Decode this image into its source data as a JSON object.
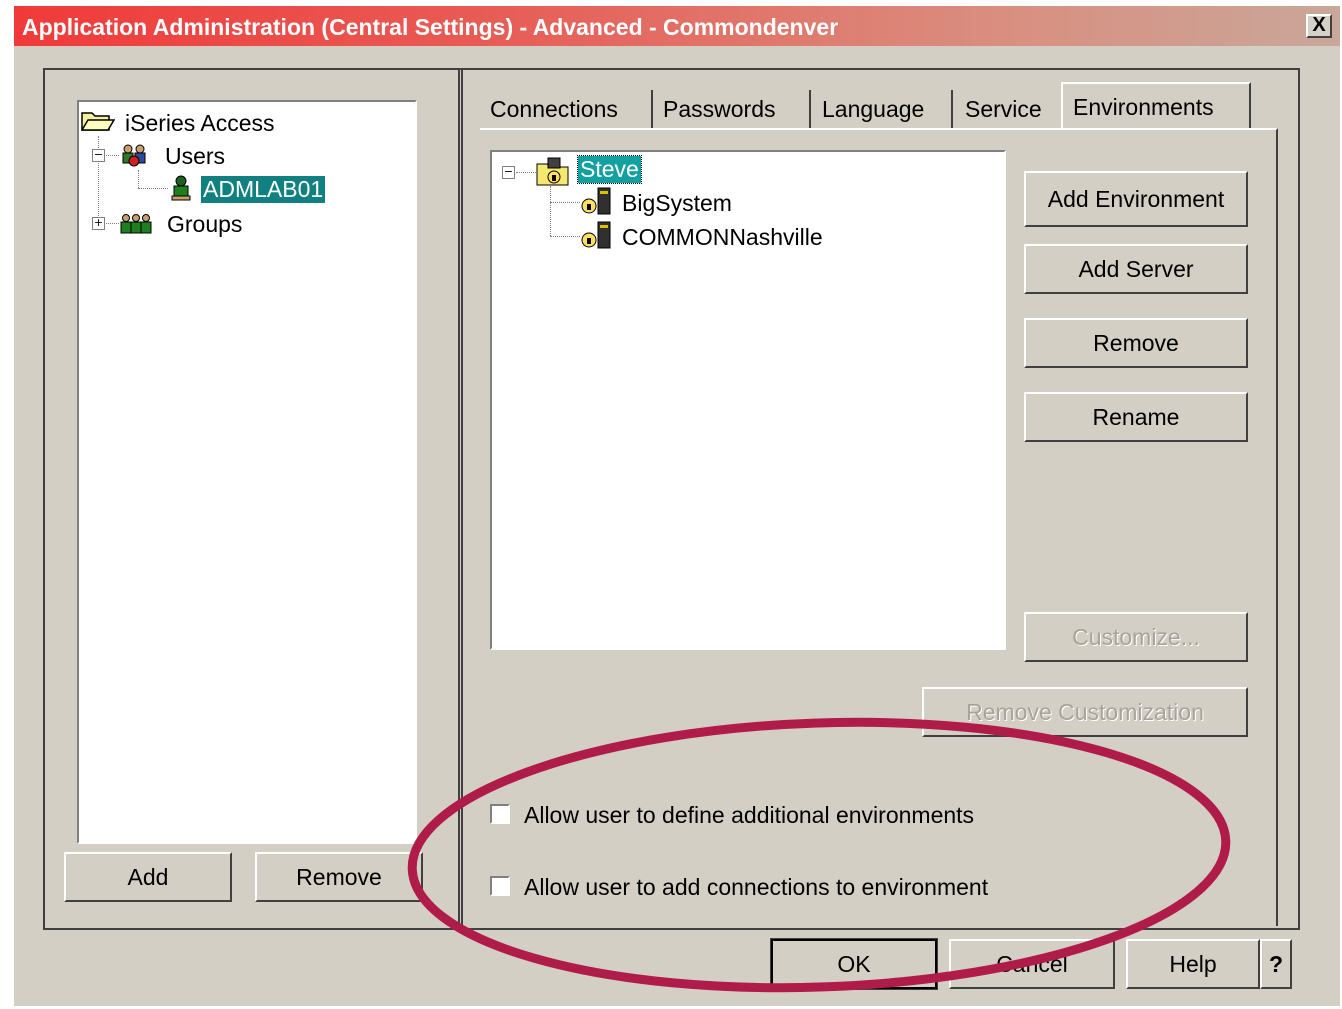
{
  "window": {
    "title": "Application Administration (Central Settings) - Advanced - Commondenver",
    "close_glyph": "X"
  },
  "left_tree": {
    "root_label": "iSeries Access",
    "users_label": "Users",
    "user_item": "ADMLAB01",
    "groups_label": "Groups",
    "users_expander": "−",
    "groups_expander": "+"
  },
  "left_buttons": {
    "add": "Add",
    "remove": "Remove"
  },
  "tabs": [
    "Connections",
    "Passwords",
    "Language",
    "Service",
    "Environments"
  ],
  "active_tab": "Environments",
  "env_tree": {
    "root_label": "Steve",
    "root_expander": "−",
    "servers": [
      "BigSystem",
      "COMMONNashville"
    ]
  },
  "env_buttons": {
    "add_environment": "Add Environment",
    "add_server": "Add Server",
    "remove": "Remove",
    "rename": "Rename",
    "customize": "Customize...",
    "remove_customization": "Remove Customization"
  },
  "options": {
    "allow_define_env": {
      "label": "Allow user to define additional environments",
      "checked": false
    },
    "allow_add_connections": {
      "label": "Allow user to add connections to environment",
      "checked": false
    }
  },
  "footer_buttons": {
    "ok": "OK",
    "cancel": "Cancel",
    "help": "Help",
    "whats_this": "?"
  },
  "colors": {
    "titlebar_start": "#f03a3a",
    "selection": "#118080",
    "annotation_ellipse": "#b01c4a"
  }
}
